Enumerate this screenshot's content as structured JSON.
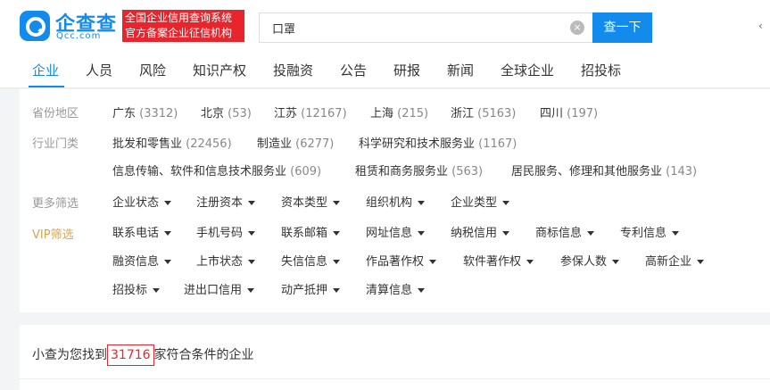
{
  "header": {
    "logo_cn": "企查查",
    "logo_en": "Qcc.com",
    "slogan_line1": "全国企业信用查询系统",
    "slogan_line2": "官方备案企业征信机构",
    "search_value": "口罩",
    "search_button": "查一下"
  },
  "tabs": [
    "企业",
    "人员",
    "风险",
    "知识产权",
    "投融资",
    "公告",
    "研报",
    "新闻",
    "全球企业",
    "招投标"
  ],
  "filters": {
    "region_label": "省份地区",
    "regions": [
      {
        "name": "广东",
        "count": "(3312)"
      },
      {
        "name": "北京",
        "count": "(53)"
      },
      {
        "name": "江苏",
        "count": "(12167)"
      },
      {
        "name": "上海",
        "count": "(215)"
      },
      {
        "name": "浙江",
        "count": "(5163)"
      },
      {
        "name": "四川",
        "count": "(197)"
      }
    ],
    "industry_label": "行业门类",
    "industries": [
      {
        "name": "批发和零售业",
        "count": "(22456)"
      },
      {
        "name": "制造业",
        "count": "(6277)"
      },
      {
        "name": "科学研究和技术服务业",
        "count": "(1167)"
      },
      {
        "name": "信息传输、软件和信息技术服务业",
        "count": "(609)"
      },
      {
        "name": "租赁和商务服务业",
        "count": "(563)"
      },
      {
        "name": "居民服务、修理和其他服务业",
        "count": "(143)"
      }
    ],
    "more_label": "更多筛选",
    "more": [
      "企业状态",
      "注册资本",
      "资本类型",
      "组织机构",
      "企业类型"
    ],
    "vip_label": "VIP筛选",
    "vip": [
      "联系电话",
      "手机号码",
      "联系邮箱",
      "网址信息",
      "纳税信用",
      "商标信息",
      "专利信息",
      "融资信息",
      "上市状态",
      "失信信息",
      "作品著作权",
      "软件著作权",
      "参保人数",
      "高新企业",
      "招投标",
      "进出口信用",
      "动产抵押",
      "清算信息"
    ]
  },
  "result": {
    "prefix": "小查为您找到",
    "count": "31716",
    "suffix": "家符合条件的企业"
  }
}
